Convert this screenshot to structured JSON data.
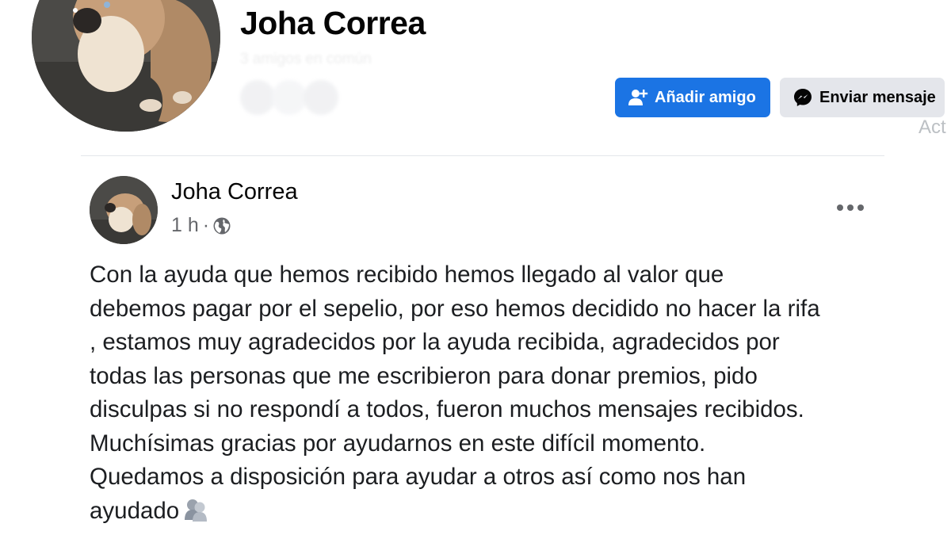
{
  "profile": {
    "name": "Joha Correa",
    "friends_text": "3   amigos en común"
  },
  "actions": {
    "add_friend_label": "Añadir amigo",
    "send_message_label": "Enviar mensaje",
    "cut_text": "Act"
  },
  "post": {
    "author": "Joha Correa",
    "time": "1 h",
    "separator": "·",
    "privacy_icon": "globe-icon",
    "body": "Con la ayuda que hemos recibido hemos llegado al valor que\ndebemos pagar por el sepelio, por eso hemos decidido no hacer la rifa\n, estamos muy agradecidos por la ayuda recibida, agradecidos por\ntodas las personas que me escribieron para donar premios, pido\ndisculpas si no respondí a todos, fueron muchos mensajes recibidos.\nMuchísimas gracias por ayudarnos en este difícil momento.\nQuedamos a disposición para ayudar a otros así como nos han\nayudado",
    "emoji": "hug-emoji-icon"
  },
  "colors": {
    "primary": "#1b74e4",
    "secondary_button": "#e4e6eb",
    "muted_text": "#65676b"
  }
}
